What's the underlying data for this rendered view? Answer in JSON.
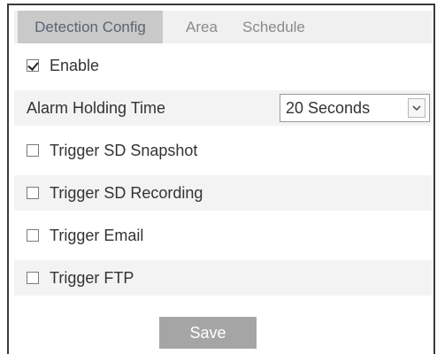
{
  "tabs": [
    {
      "label": "Detection Config",
      "active": true
    },
    {
      "label": "Area",
      "active": false
    },
    {
      "label": "Schedule",
      "active": false
    }
  ],
  "enable": {
    "label": "Enable",
    "checked": true
  },
  "alarm_holding": {
    "label": "Alarm Holding Time",
    "selected": "20 Seconds"
  },
  "triggers": [
    {
      "label": "Trigger SD Snapshot",
      "checked": false
    },
    {
      "label": "Trigger SD Recording",
      "checked": false
    },
    {
      "label": "Trigger Email",
      "checked": false
    },
    {
      "label": "Trigger FTP",
      "checked": false
    }
  ],
  "save_label": "Save",
  "colors": {
    "tab_active_bg": "#c9c9c9",
    "save_bg": "#a5a5a5",
    "stripe": "#f3f3f3"
  }
}
